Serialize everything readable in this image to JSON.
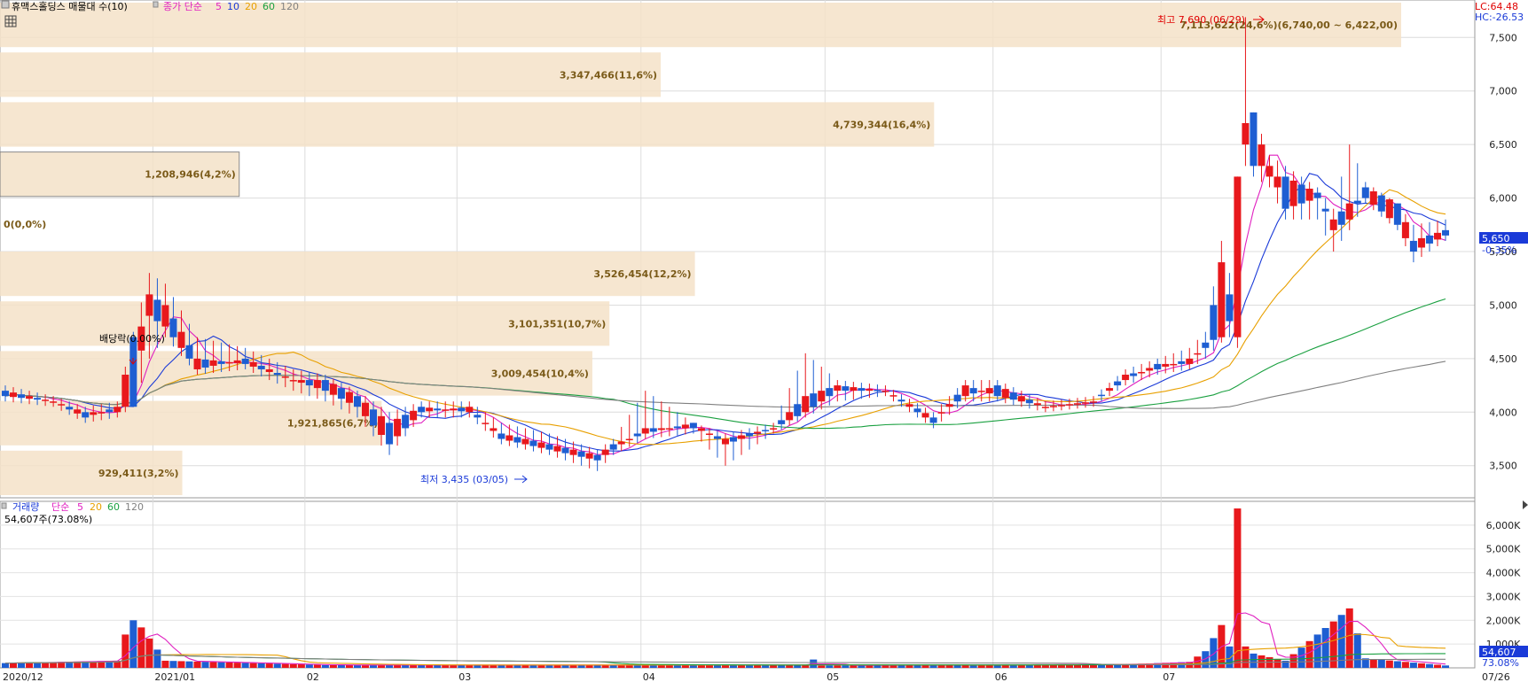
{
  "price_legend": {
    "title": "휴맥스홀딩스 매물대 수(10)",
    "ma_label": "종가 단순",
    "ma": [
      {
        "period": "5",
        "color": "#e020c0"
      },
      {
        "period": "10",
        "color": "#1a3ad8"
      },
      {
        "period": "20",
        "color": "#e8a000"
      },
      {
        "period": "60",
        "color": "#1aa040"
      },
      {
        "period": "120",
        "color": "#808080"
      }
    ]
  },
  "right_info": {
    "lc": "LC:64.48",
    "hc": "HC:-26.53"
  },
  "current": {
    "price": "5,650",
    "change": "-0.35%"
  },
  "annotations": {
    "high": "최고 7,690 (06/29)",
    "low": "최저 3,435 (03/05)",
    "ex_div": "배당락(0.00%)"
  },
  "volume_legend": {
    "title": "거래량",
    "ma_label": "단순",
    "ma": [
      {
        "period": "5",
        "color": "#e020c0"
      },
      {
        "period": "20",
        "color": "#e8a000"
      },
      {
        "period": "60",
        "color": "#1aa040"
      },
      {
        "period": "120",
        "color": "#808080"
      }
    ],
    "info": "54,607주(73.08%)"
  },
  "current_volume": {
    "value": "54,607",
    "ratio": "73.08%"
  },
  "chart_data": [
    {
      "type": "candlestick",
      "ylim": [
        3200,
        7850
      ],
      "yticks": [
        3500,
        4000,
        4500,
        5000,
        5500,
        6000,
        6500,
        7000,
        7500
      ],
      "ytick_labels": [
        "3,500",
        "4,000",
        "4,500",
        "5,000",
        "5,500",
        "6,000",
        "6,500",
        "7,000",
        "7,500"
      ],
      "xtick_labels": [
        "2020/12",
        "2021/01",
        "02",
        "03",
        "04",
        "05",
        "06",
        "07",
        "07/26"
      ],
      "ohlc_knots": [
        [
          0,
          4200,
          4250,
          4100,
          4150
        ],
        [
          6,
          4100,
          4150,
          4050,
          4100
        ],
        [
          10,
          4000,
          4050,
          3900,
          3950
        ],
        [
          14,
          4000,
          4100,
          3950,
          4050
        ],
        [
          16,
          4700,
          4750,
          4050,
          4050
        ],
        [
          18,
          4900,
          5300,
          4500,
          5100
        ],
        [
          20,
          4800,
          5200,
          4700,
          5000
        ],
        [
          24,
          4400,
          4700,
          4350,
          4500
        ],
        [
          30,
          4500,
          4600,
          4400,
          4450
        ],
        [
          36,
          4300,
          4400,
          4200,
          4300
        ],
        [
          40,
          4300,
          4350,
          4100,
          4200
        ],
        [
          44,
          4150,
          4200,
          3950,
          4050
        ],
        [
          48,
          3900,
          4000,
          3600,
          3700
        ],
        [
          52,
          4050,
          4100,
          3950,
          4000
        ],
        [
          58,
          4000,
          4100,
          3950,
          4050
        ],
        [
          62,
          3800,
          3900,
          3700,
          3750
        ],
        [
          68,
          3700,
          3800,
          3600,
          3650
        ],
        [
          74,
          3600,
          3650,
          3450,
          3550
        ],
        [
          76,
          3700,
          3750,
          3600,
          3650
        ],
        [
          80,
          3800,
          4200,
          3750,
          3850
        ],
        [
          86,
          3900,
          3900,
          3800,
          3850
        ],
        [
          90,
          3700,
          3800,
          3500,
          3750
        ],
        [
          96,
          3850,
          3900,
          3800,
          3850
        ],
        [
          100,
          4000,
          4550,
          3950,
          4150
        ],
        [
          104,
          4200,
          4300,
          4100,
          4250
        ],
        [
          110,
          4200,
          4250,
          4150,
          4200
        ],
        [
          116,
          3950,
          4000,
          3850,
          3900
        ],
        [
          120,
          4150,
          4300,
          4100,
          4250
        ],
        [
          124,
          4250,
          4300,
          4100,
          4150
        ],
        [
          130,
          4050,
          4100,
          4000,
          4050
        ],
        [
          136,
          4100,
          4150,
          4050,
          4100
        ],
        [
          140,
          4300,
          4400,
          4250,
          4350
        ],
        [
          144,
          4450,
          4500,
          4350,
          4400
        ],
        [
          148,
          4450,
          4600,
          4400,
          4500
        ],
        [
          150,
          4650,
          4750,
          4500,
          4600
        ],
        [
          152,
          4700,
          5600,
          4650,
          5400
        ],
        [
          153,
          5100,
          5300,
          4700,
          4850
        ],
        [
          154,
          4700,
          6200,
          4600,
          6200
        ],
        [
          155,
          6500,
          7690,
          6300,
          6700
        ],
        [
          156,
          6800,
          6800,
          6200,
          6300
        ],
        [
          158,
          6200,
          6400,
          6100,
          6300
        ],
        [
          160,
          6200,
          6300,
          5800,
          5900
        ],
        [
          164,
          6050,
          6100,
          5800,
          6000
        ],
        [
          166,
          5700,
          5900,
          5500,
          5800
        ],
        [
          168,
          5800,
          6500,
          5700,
          5950
        ],
        [
          170,
          6100,
          6150,
          5950,
          6000
        ],
        [
          174,
          5950,
          5950,
          5700,
          5750
        ],
        [
          176,
          5600,
          5750,
          5400,
          5500
        ],
        [
          180,
          5700,
          5800,
          5600,
          5650
        ]
      ],
      "volume_profile": [
        {
          "label": "929,411(3,2%)",
          "share": 3.2
        },
        {
          "label": "1,921,865(6,7%)",
          "share": 6.7
        },
        {
          "label": "3,009,454(10,4%)",
          "share": 10.4
        },
        {
          "label": "3,101,351(10,7%)",
          "share": 10.7
        },
        {
          "label": "3,526,454(12,2%)",
          "share": 12.2
        },
        {
          "label": "0(0,0%)",
          "share": 0
        },
        {
          "label": "1,208,946(4,2%)",
          "share": 4.2
        },
        {
          "label": "4,739,344(16,4%)",
          "share": 16.4
        },
        {
          "label": "3,347,466(11,6%)",
          "share": 11.6
        },
        {
          "label": "7,113,622(24,6%)(6,740,00 ~ 6,422,00)",
          "share": 24.6
        }
      ]
    },
    {
      "type": "bar",
      "ylim": [
        0,
        7000000
      ],
      "yticks": [
        1000000,
        2000000,
        3000000,
        4000000,
        5000000,
        6000000
      ],
      "ytick_labels": [
        "1,000K",
        "2,000K",
        "3,000K",
        "4,000K",
        "5,000K",
        "6,000K"
      ],
      "volume_knots": [
        [
          0,
          200000
        ],
        [
          14,
          300000
        ],
        [
          15,
          1400000
        ],
        [
          16,
          2000000
        ],
        [
          17,
          1700000
        ],
        [
          20,
          300000
        ],
        [
          40,
          120000
        ],
        [
          100,
          120000
        ],
        [
          101,
          350000
        ],
        [
          102,
          100000
        ],
        [
          140,
          150000
        ],
        [
          148,
          250000
        ],
        [
          150,
          700000
        ],
        [
          152,
          1800000
        ],
        [
          153,
          900000
        ],
        [
          154,
          6700000
        ],
        [
          155,
          900000
        ],
        [
          156,
          600000
        ],
        [
          160,
          300000
        ],
        [
          168,
          2500000
        ],
        [
          170,
          400000
        ],
        [
          180,
          100000
        ]
      ]
    }
  ]
}
